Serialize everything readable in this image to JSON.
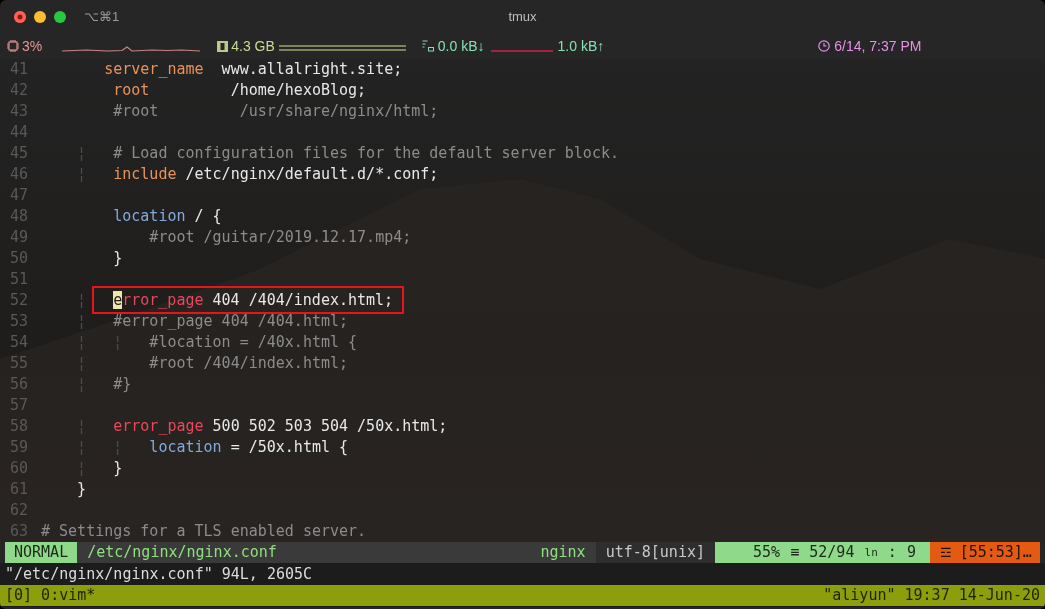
{
  "window": {
    "title": "tmux",
    "shortcut": "⌥⌘1"
  },
  "stats": {
    "cpu": "3%",
    "memory": "4.3 GB",
    "net_down": "0.0 kB↓",
    "net_up": "1.0 kB↑",
    "clock": "6/14, 7:37 PM"
  },
  "editor": {
    "lines": [
      {
        "number": "41",
        "highlighted": false,
        "tokens": [
          {
            "kind": "keyword",
            "text": "       server_name"
          },
          {
            "kind": "plain",
            "text": "  www.allalright.site;"
          }
        ]
      },
      {
        "number": "42",
        "highlighted": false,
        "tokens": [
          {
            "kind": "keyword",
            "text": "        root"
          },
          {
            "kind": "plain",
            "text": "         /home/hexoBlog;"
          }
        ]
      },
      {
        "number": "43",
        "highlighted": false,
        "tokens": [
          {
            "kind": "comment",
            "text": "        #root         /usr/share/nginx/html;"
          }
        ]
      },
      {
        "number": "44",
        "highlighted": false
      },
      {
        "number": "45",
        "highlighted": false,
        "tokens": [
          {
            "kind": "guide",
            "text": "    ¦"
          },
          {
            "kind": "comment",
            "text": "   # Load configuration files for the default server block."
          }
        ]
      },
      {
        "number": "46",
        "highlighted": false,
        "tokens": [
          {
            "kind": "guide",
            "text": "    ¦"
          },
          {
            "kind": "keyword",
            "text": "   include"
          },
          {
            "kind": "plain",
            "text": " /etc/nginx/default.d/*.conf;"
          }
        ]
      },
      {
        "number": "47",
        "highlighted": false
      },
      {
        "number": "48",
        "highlighted": false,
        "tokens": [
          {
            "kind": "builtin",
            "text": "        location"
          },
          {
            "kind": "plain",
            "text": " / {"
          }
        ]
      },
      {
        "number": "49",
        "highlighted": false,
        "tokens": [
          {
            "kind": "comment",
            "text": "            #root /guitar/2019.12.17.mp4;"
          }
        ]
      },
      {
        "number": "50",
        "highlighted": false,
        "tokens": [
          {
            "kind": "plain",
            "text": "        }"
          }
        ]
      },
      {
        "number": "51",
        "highlighted": false
      },
      {
        "number": "52",
        "highlighted": true,
        "tokens": [
          {
            "kind": "guide",
            "text": "    ¦ "
          },
          {
            "kind": "cursor",
            "text": "e"
          },
          {
            "kind": "directive",
            "text": "rror_page"
          },
          {
            "kind": "plain",
            "text": " 404 /404/index.html;"
          }
        ]
      },
      {
        "number": "53",
        "highlighted": false,
        "tokens": [
          {
            "kind": "guide",
            "text": "    ¦"
          },
          {
            "kind": "comment",
            "text": "   #error_page 404 /404.html;"
          }
        ]
      },
      {
        "number": "54",
        "highlighted": false,
        "tokens": [
          {
            "kind": "guide",
            "text": "    ¦   ¦"
          },
          {
            "kind": "comment",
            "text": "   #location = /40x.html {"
          }
        ]
      },
      {
        "number": "55",
        "highlighted": false,
        "tokens": [
          {
            "kind": "guide",
            "text": "    ¦"
          },
          {
            "kind": "comment",
            "text": "       #root /404/index.html;"
          }
        ]
      },
      {
        "number": "56",
        "highlighted": false,
        "tokens": [
          {
            "kind": "guide",
            "text": "    ¦"
          },
          {
            "kind": "comment",
            "text": "   #}"
          }
        ]
      },
      {
        "number": "57",
        "highlighted": false
      },
      {
        "number": "58",
        "highlighted": false,
        "tokens": [
          {
            "kind": "guide",
            "text": "    ¦"
          },
          {
            "kind": "directive",
            "text": "   error_page"
          },
          {
            "kind": "plain",
            "text": " 500 502 503 504 /50x.html;"
          }
        ]
      },
      {
        "number": "59",
        "highlighted": false,
        "tokens": [
          {
            "kind": "guide",
            "text": "    ¦   ¦"
          },
          {
            "kind": "builtin",
            "text": "   location"
          },
          {
            "kind": "plain",
            "text": " = /50x.html {"
          }
        ]
      },
      {
        "number": "60",
        "highlighted": false,
        "tokens": [
          {
            "kind": "guide",
            "text": "    ¦"
          },
          {
            "kind": "plain",
            "text": "   }"
          }
        ]
      },
      {
        "number": "61",
        "highlighted": false,
        "tokens": [
          {
            "kind": "plain",
            "text": "    }"
          }
        ]
      },
      {
        "number": "62",
        "highlighted": false
      },
      {
        "number": "63",
        "highlighted": false,
        "tokens": [
          {
            "kind": "comment",
            "text": "# Settings for a TLS enabled server."
          }
        ]
      }
    ]
  },
  "statusline": {
    "mode": "NORMAL",
    "file": "/etc/nginx/nginx.conf",
    "filetype": "nginx",
    "encoding": "utf-8[unix]",
    "percent": "55%",
    "percent_icon": "≡",
    "position": "52/94",
    "line_icon": "ln",
    "separator": ":",
    "column": "9",
    "warning_icon": "☲",
    "warning": "[55:53]…"
  },
  "message": "\"/etc/nginx/nginx.conf\" 94L, 2605C",
  "tmux": {
    "window": "[0] 0:vim*",
    "status": "\"aliyun\" 19:37 14-Jun-20"
  }
}
